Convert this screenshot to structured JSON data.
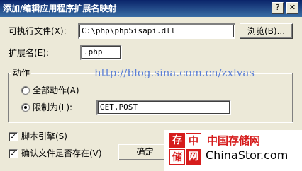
{
  "window": {
    "title": "添加/编辑应用程序扩展名映射",
    "help_glyph": "?",
    "close_glyph": "✕"
  },
  "executable": {
    "label": "可执行文件(X):",
    "value": "C:\\php\\php5isapi.dll",
    "browse_label": "浏览(B)..."
  },
  "extension": {
    "label": "扩展名(E):",
    "value": ".php"
  },
  "verbs": {
    "group_label": "动作",
    "all_label": "全部动作(A)",
    "limit_label": "限制为(L):",
    "limit_value": "GET,POST",
    "selected": "limit"
  },
  "options": {
    "script_engine_label": "脚本引擎(S)",
    "script_engine_checked": true,
    "verify_file_label": "确认文件是否存在(V)",
    "verify_file_checked": true
  },
  "buttons": {
    "ok_label": "确定"
  },
  "overlay": {
    "watermark_url": "http://blog.sina.com.cn/zxlvas",
    "logo_chars": [
      "存",
      "中",
      "储",
      "网"
    ],
    "logo_cn": "中国存储网",
    "logo_en": "ChinaStor.com"
  },
  "colors": {
    "titlebar": "#0a246a",
    "face": "#ece9d8",
    "watermark": "#5b7fd6",
    "logo_red": "#d61c1c"
  }
}
